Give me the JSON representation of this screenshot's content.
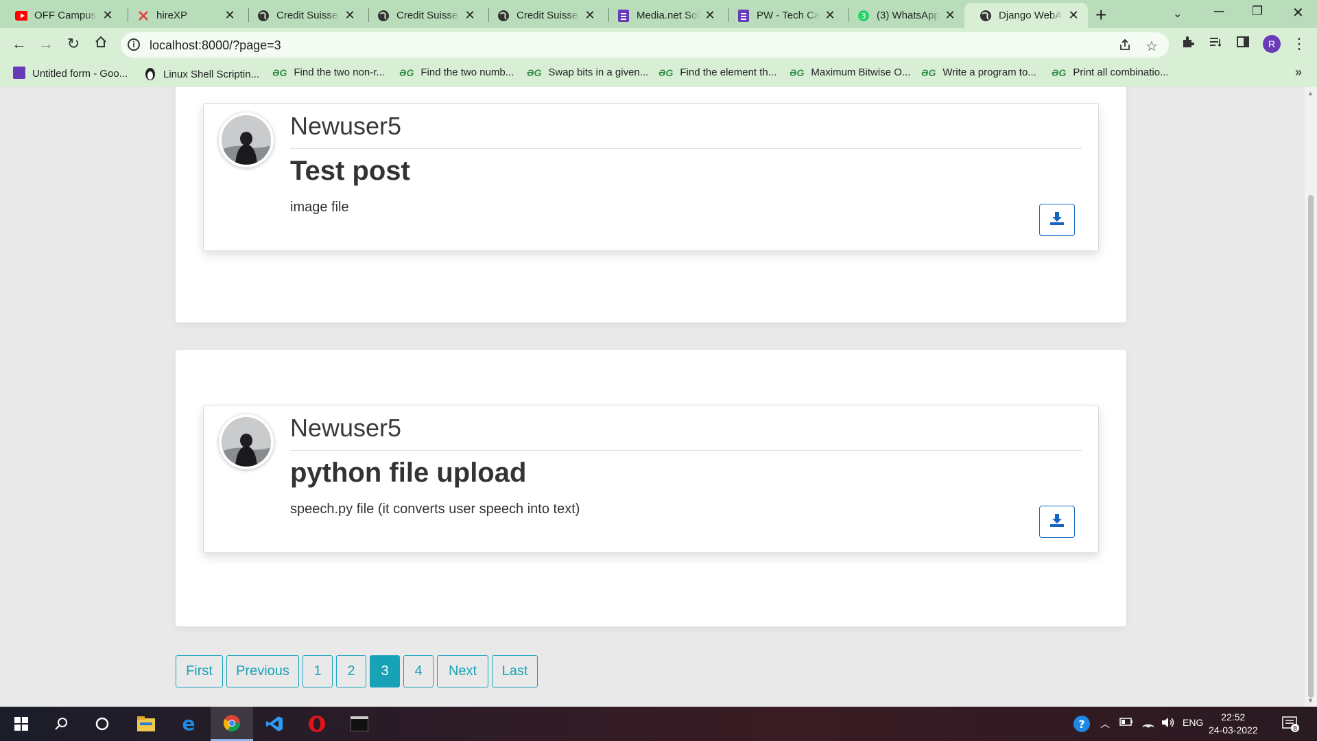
{
  "tabs": [
    {
      "title": "OFF Campus P",
      "icon": "youtube-icon"
    },
    {
      "title": "hireXP",
      "icon": "hirexp-icon"
    },
    {
      "title": "Credit Suisse (",
      "icon": "globe-icon"
    },
    {
      "title": "Credit Suisse (",
      "icon": "globe-icon"
    },
    {
      "title": "Credit Suisse (",
      "icon": "globe-icon"
    },
    {
      "title": "Media.net Sof",
      "icon": "forms-icon"
    },
    {
      "title": "PW - Tech Car",
      "icon": "forms-icon"
    },
    {
      "title": "(3) WhatsApp",
      "icon": "whatsapp-icon",
      "badge": "3"
    },
    {
      "title": "Django WebA",
      "icon": "globe-icon",
      "active": true
    }
  ],
  "address_bar": {
    "url": "localhost:8000/?page=3"
  },
  "profile": {
    "initial": "R"
  },
  "bookmarks": [
    {
      "label": "Untitled form - Goo...",
      "icon": "forms-icon"
    },
    {
      "label": "Linux Shell Scriptin...",
      "icon": "linux-icon"
    },
    {
      "label": "Find the two non-r...",
      "icon": "gfg-icon"
    },
    {
      "label": "Find the two numb...",
      "icon": "gfg-icon"
    },
    {
      "label": "Swap bits in a given...",
      "icon": "gfg-icon"
    },
    {
      "label": "Find the element th...",
      "icon": "gfg-icon"
    },
    {
      "label": "Maximum Bitwise O...",
      "icon": "gfg-icon"
    },
    {
      "label": "Write a program to...",
      "icon": "gfg-icon"
    },
    {
      "label": "Print all combinatio...",
      "icon": "gfg-icon"
    }
  ],
  "posts": [
    {
      "username": "Newuser5",
      "title": "Test post",
      "description": "image file"
    },
    {
      "username": "Newuser5",
      "title": "python file upload",
      "description": "speech.py file (it converts user speech into text)"
    }
  ],
  "pagination": {
    "first": "First",
    "previous": "Previous",
    "pages": [
      "1",
      "2",
      "3",
      "4"
    ],
    "current": "3",
    "next": "Next",
    "last": "Last"
  },
  "taskbar": {
    "language": "ENG",
    "time": "22:52",
    "date": "24-03-2022",
    "notification_count": "8"
  },
  "colors": {
    "accent": "#17a2b8",
    "download_button": "#1565c0",
    "chrome_frame": "#b9dcbb"
  }
}
